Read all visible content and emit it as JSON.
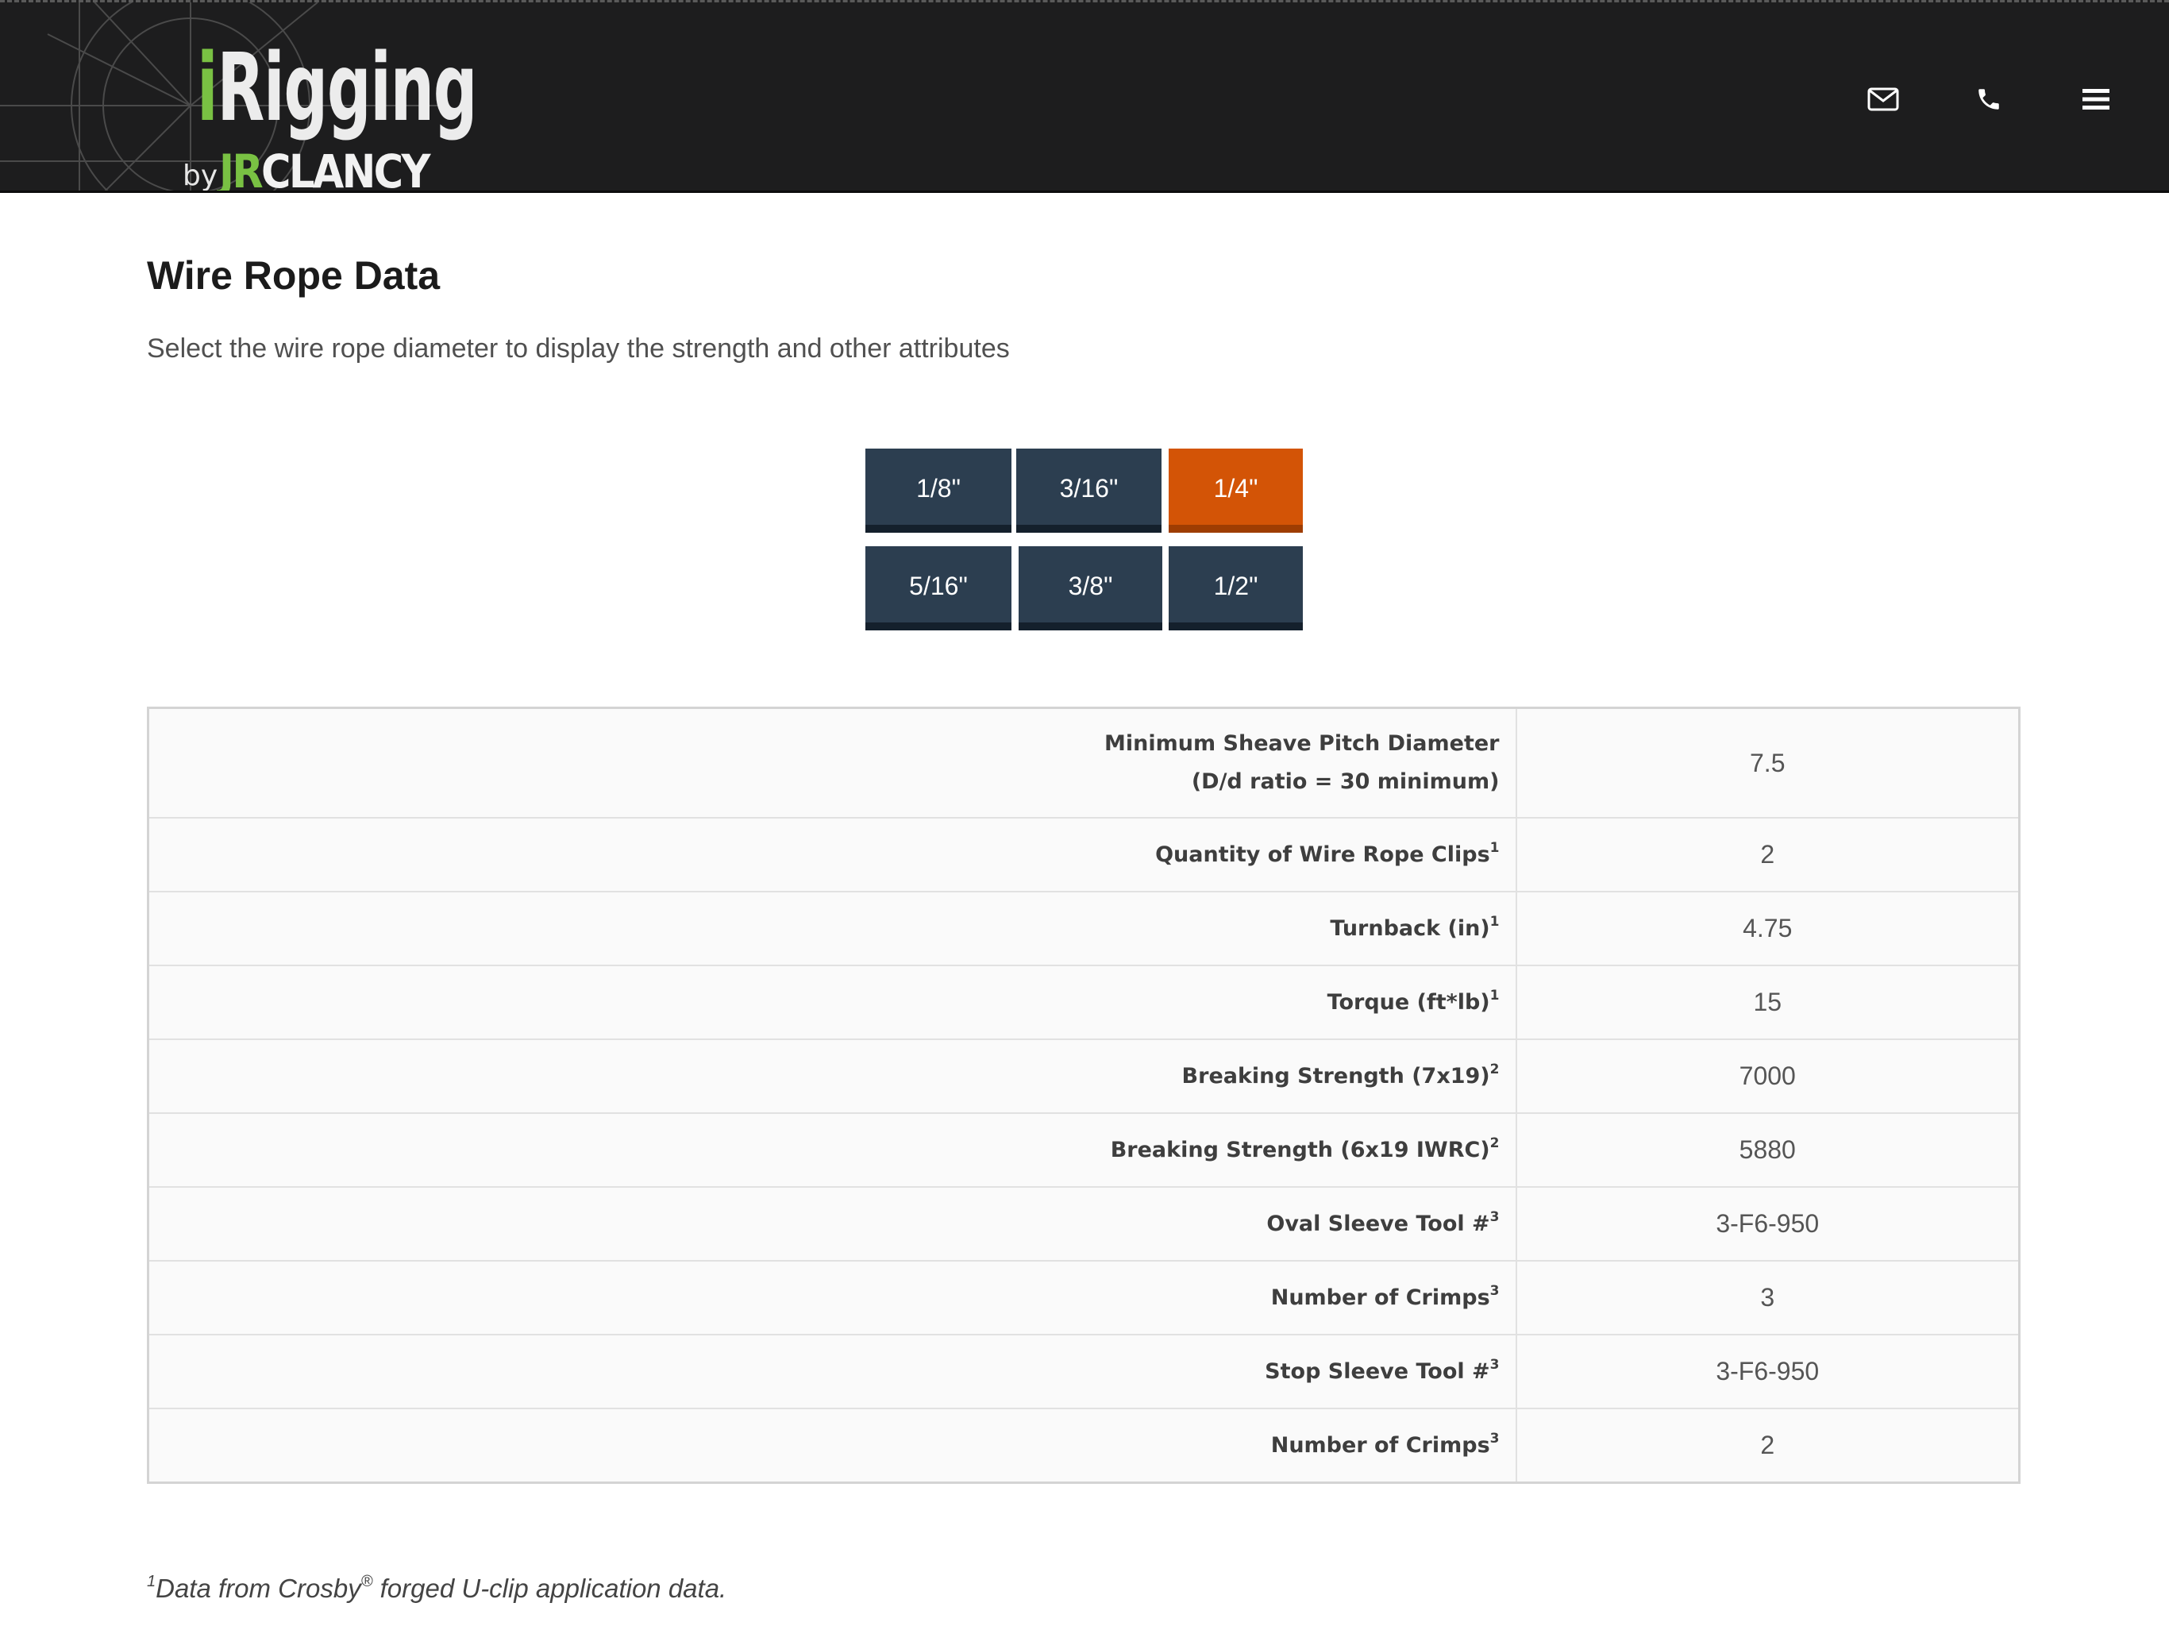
{
  "header": {
    "logo": {
      "i_letter": "i",
      "wordmark_rest": "Rigging",
      "by": "by",
      "brand_jr": "JR",
      "brand_name": "CLANCY"
    },
    "icons": {
      "mail": "envelope-icon",
      "phone": "phone-icon",
      "menu": "hamburger-menu-icon"
    }
  },
  "main": {
    "title": "Wire Rope Data",
    "subtitle": "Select the wire rope diameter to display the strength and other attributes"
  },
  "diameter_buttons": [
    {
      "label": "1/8\"",
      "active": false
    },
    {
      "label": "3/16\"",
      "active": false
    },
    {
      "label": "1/4\"",
      "active": true
    },
    {
      "label": "5/16\"",
      "active": false
    },
    {
      "label": "3/8\"",
      "active": false
    },
    {
      "label": "1/2\"",
      "active": false
    }
  ],
  "table": {
    "rows": [
      {
        "label_line1": "Minimum Sheave Pitch Diameter",
        "label_line2": "(D/d ratio = 30 minimum)",
        "value": "7.5"
      },
      {
        "label": "Quantity of Wire Rope Clips",
        "sup": "1",
        "value": "2"
      },
      {
        "label": "Turnback (in)",
        "sup": "1",
        "value": "4.75"
      },
      {
        "label": "Torque (ft*lb)",
        "sup": "1",
        "value": "15"
      },
      {
        "label": "Breaking Strength (7x19)",
        "sup": "2",
        "value": "7000"
      },
      {
        "label": "Breaking Strength (6x19 IWRC)",
        "sup": "2",
        "value": "5880"
      },
      {
        "label": "Oval Sleeve Tool #",
        "sup": "3",
        "value": "3-F6-950"
      },
      {
        "label": "Number of Crimps",
        "sup": "3",
        "value": "3"
      },
      {
        "label": "Stop Sleeve Tool #",
        "sup": "3",
        "value": "3-F6-950"
      },
      {
        "label": "Number of Crimps",
        "sup": "3",
        "value": "2"
      }
    ]
  },
  "footnote": {
    "marker": "1",
    "text_before": "Data from Crosby",
    "registered": "®",
    "text_after": " forged U-clip application data."
  },
  "colors": {
    "header_bg": "#1d1d1e",
    "logo_green": "#79c143",
    "button_bg": "#2c3e50",
    "button_active_bg": "#d35406",
    "table_bg": "#fafafa"
  }
}
